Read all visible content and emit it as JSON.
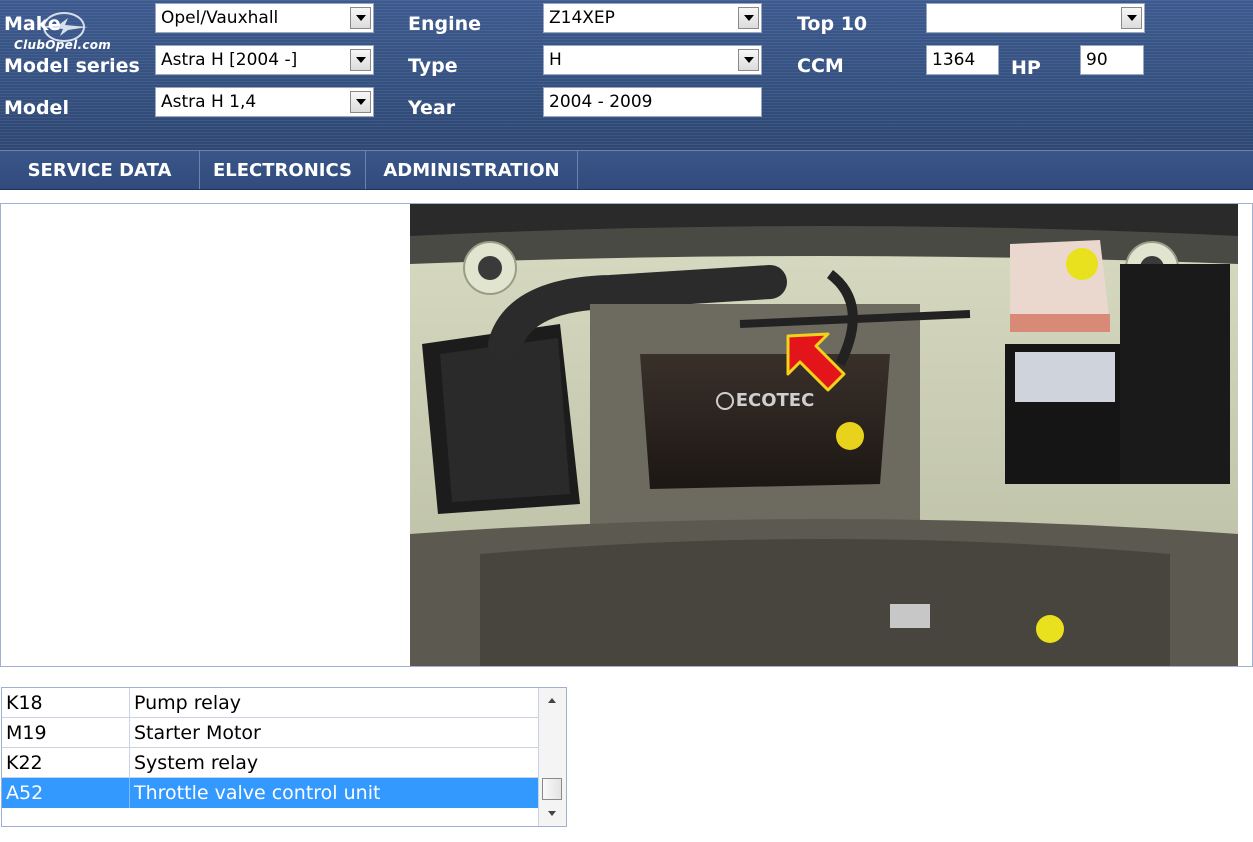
{
  "header": {
    "logo_text": "ClubOpel.com",
    "make": {
      "label": "Make",
      "value": "Opel/Vauxhall"
    },
    "model_series": {
      "label": "Model series",
      "value": "Astra H [2004 -]"
    },
    "model": {
      "label": "Model",
      "value": "Astra H 1,4"
    },
    "engine": {
      "label": "Engine",
      "value": "Z14XEP"
    },
    "type": {
      "label": "Type",
      "value": "H"
    },
    "year": {
      "label": "Year",
      "value": "2004 - 2009"
    },
    "top10": {
      "label": "Top 10",
      "value": ""
    },
    "ccm": {
      "label": "CCM",
      "value": "1364"
    },
    "hp": {
      "label": "HP",
      "value": "90"
    }
  },
  "tabs": [
    {
      "label": "SERVICE DATA"
    },
    {
      "label": "ELECTRONICS"
    },
    {
      "label": "ADMINISTRATION"
    }
  ],
  "photo": {
    "engine_cover_label": "ECOTEC",
    "arrow_color": "#e3141a",
    "arrow_outline": "#f2d21a"
  },
  "components": [
    {
      "code": "K18",
      "name": "Pump relay"
    },
    {
      "code": "M19",
      "name": "Starter Motor"
    },
    {
      "code": "K22",
      "name": "System relay"
    },
    {
      "code": "A52",
      "name": "Throttle valve control unit",
      "selected": true
    }
  ],
  "colors": {
    "header_bg": "#34507f",
    "selection": "#3399ff"
  }
}
